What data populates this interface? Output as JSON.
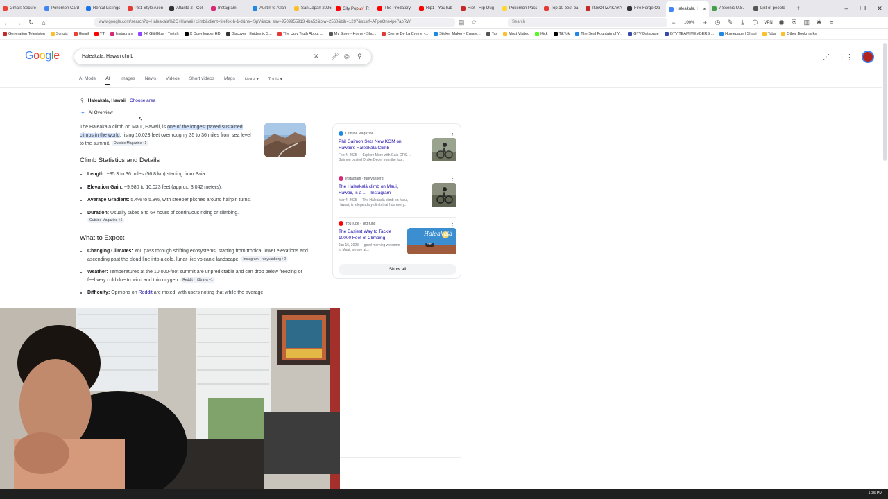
{
  "browser": {
    "tabs": [
      {
        "label": "Gmail: Secure",
        "color": "#ea4335"
      },
      {
        "label": "Pokémon Card",
        "color": "#4285f4"
      },
      {
        "label": "Rental Listings",
        "color": "#1a73e8"
      },
      {
        "label": "PS1 Style Alien",
        "color": "#e53935"
      },
      {
        "label": "Atlanta 2 - Col",
        "color": "#333333"
      },
      {
        "label": "Instagram",
        "color": "#d62976"
      },
      {
        "label": "Austin to Atlan",
        "color": "#1e88e5"
      },
      {
        "label": "San Japan 2026 Ti",
        "color": "#fbc02d"
      },
      {
        "label": "City Pop 🎸 R",
        "color": "#ff0000"
      },
      {
        "label": "The Predatory",
        "color": "#ff0000"
      },
      {
        "label": "Rip1 - YouTub",
        "color": "#ff0000"
      },
      {
        "label": "Rip! - Rip Oug",
        "color": "#c62828"
      },
      {
        "label": "Pokemon Pass",
        "color": "#fdd835"
      },
      {
        "label": "Top 10 best ba",
        "color": "#e53935"
      },
      {
        "label": "INSOI IZAKAYA",
        "color": "#c62828"
      },
      {
        "label": "Fire Forge Op",
        "color": "#333333"
      },
      {
        "label": "Haleakala, I",
        "color": "#4285f4",
        "active": true
      },
      {
        "label": "7 Scenic U.S.",
        "color": "#43a047"
      },
      {
        "label": "List of people",
        "color": "#555555"
      }
    ],
    "url": "www.google.com/search?q=Haleakala%2C+Hawaii+climb&client=firefox-b-1-d&hs=jSpV&sca_esv=9509955913 4ba52&biw=2560&bih=1297&sxsrf=AFpeOns4pe7apRW",
    "search_placeholder": "Search",
    "zoom": "100%",
    "vpn": "VPN",
    "bookmarks": [
      {
        "label": "Generation Television",
        "color": "#c62828"
      },
      {
        "label": "Scripts",
        "color": "#fbc02d"
      },
      {
        "label": "Gmail",
        "color": "#ea4335"
      },
      {
        "label": "YT",
        "color": "#ff0000"
      },
      {
        "label": "Instagram",
        "color": "#d62976"
      },
      {
        "label": "[4] GlitiGlow - Twitch",
        "color": "#9146ff"
      },
      {
        "label": "X Downloader HD",
        "color": "#000000"
      },
      {
        "label": "Discover | Epidemic S...",
        "color": "#333333"
      },
      {
        "label": "The Ugly Truth About ...",
        "color": "#e53935"
      },
      {
        "label": "My Store - Home - Sho...",
        "color": "#555555"
      },
      {
        "label": "Creme De La Creme -...",
        "color": "#e53935"
      },
      {
        "label": "Sticker Maker - Create...",
        "color": "#1e88e5"
      },
      {
        "label": "Tax",
        "color": "#555555"
      },
      {
        "label": "Most Visited",
        "color": "#fbc02d"
      },
      {
        "label": "Kick",
        "color": "#53fc18"
      },
      {
        "label": "TikTok",
        "color": "#000000"
      },
      {
        "label": "The Seal Fountain of Y...",
        "color": "#1e88e5"
      },
      {
        "label": "GTV Database",
        "color": "#3949ab"
      },
      {
        "label": "GTV TEAM MEMBERS ...",
        "color": "#3949ab"
      },
      {
        "label": "Homepage | Shapi",
        "color": "#1e88e5"
      },
      {
        "label": "Tabs",
        "color": "#fbc02d"
      },
      {
        "label": "Other Bookmarks",
        "color": "#fbc02d"
      }
    ]
  },
  "google": {
    "logo": [
      "G",
      "o",
      "o",
      "g",
      "l",
      "e"
    ],
    "query": "Haleakala, Hawaii climb",
    "filters": [
      "AI Mode",
      "All",
      "Images",
      "News",
      "Videos",
      "Short videos",
      "Maps",
      "More ▾",
      "Tools ▾"
    ],
    "active_filter": "All"
  },
  "location": {
    "name": "Haleakala, Hawaii",
    "action": "Choose area"
  },
  "ai_overview": {
    "label": "AI Overview",
    "intro_pre": "The Haleakalā climb on Maui, Hawaii, is ",
    "intro_highlight": "one of the longest paved sustained climbs in the world",
    "intro_post": ", rising 10,023 feet over roughly 35 to 36 miles from sea level to the summit.",
    "intro_chip": "Outside Magazine +1",
    "stats_heading": "Climb Statistics and Details",
    "stats": [
      {
        "label": "Length:",
        "text": " ~35.3 to 36 miles (56.8 km) starting from Paia.",
        "chip": ""
      },
      {
        "label": "Elevation Gain:",
        "text": " ~9,980 to 10,023 feet (approx. 3,042 meters).",
        "chip": ""
      },
      {
        "label": "Average Gradient:",
        "text": " 5.4% to 5.8%, with steeper pitches around hairpin turns.",
        "chip": ""
      },
      {
        "label": "Duration:",
        "text": " Usually takes 5 to 6+ hours of continuous riding or climbing.",
        "chip": "Outside Magazine +6"
      }
    ],
    "expect_heading": "What to Expect",
    "expect": [
      {
        "label": "Changing Climates:",
        "text": " You pass through shifting ecosystems, starting from tropical lower elevations and ascending past the cloud line into a cold, lunar-like volcanic landscape.",
        "chip": "Instagram · rudyvanberg +2"
      },
      {
        "label": "Weather:",
        "text": " Temperatures at the 10,000-foot summit are unpredictable and can drop below freezing or feel very cold due to wind and thin oxygen.",
        "chip": "Reddit · r/Strava +1"
      },
      {
        "label": "Difficulty:",
        "text_pre": " Opinions on ",
        "link": "Reddit",
        "text_post": " are mixed, with users noting that while the average"
      }
    ]
  },
  "sources": [
    {
      "site": "Outside Magazine",
      "title": "Phil Gaimon Sets New KOM on Hawaii's Haleakala Climb",
      "snippet": "Feb 4, 2025 — Explore More with Gaia GPS. ... Gaimon ousted Drake Deuel from the top...",
      "fav": "#1e88e5"
    },
    {
      "site": "Instagram · rudyvanberg",
      "title": "The Haleakalā climb on Maui, Hawaii, is a ... - Instagram",
      "snippet": "Mar 4, 2025 — The Haleakalā climb on Maui, Hawaii, is a legendary climb that I do every...",
      "fav": "#d62976"
    },
    {
      "site": "YouTube · Ted King",
      "title": "The Easiest Way to Tackle 10000 Feet of Climbing",
      "snippet": "Jan 16, 2023 — good morning welcome to Maui, we are at...",
      "fav": "#ff0000",
      "video_overlay": "Haleakalā",
      "duration": "5m"
    }
  ],
  "show_all": "Show all",
  "clock": "1:35 PM"
}
